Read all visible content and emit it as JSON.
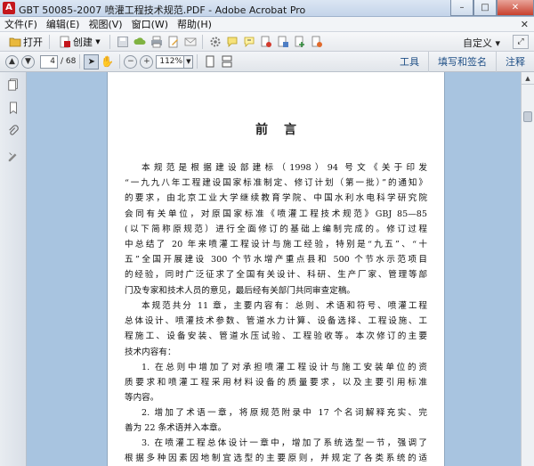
{
  "window": {
    "title": "GBT 50085-2007 喷灌工程技术规范.PDF - Adobe Acrobat Pro",
    "minimize": "–",
    "maximize": "□",
    "close": "✕"
  },
  "menu": {
    "items": [
      "文件(F)",
      "编辑(E)",
      "视图(V)",
      "窗口(W)",
      "帮助(H)"
    ],
    "close": "✕"
  },
  "toolbar": {
    "open_label": "打开",
    "create_label": "创建",
    "customize_label": "自定义"
  },
  "nav": {
    "current_page": "4",
    "total_pages": "/ 68",
    "zoom": "112%",
    "tools_label": "工具",
    "fill_sign_label": "填写和签名",
    "comment_label": "注释"
  },
  "document": {
    "heading": "前言",
    "paragraphs": [
      [
        "本规范是根据建设部建标（1998）94 号文《关于印发",
        "“一九九八年工程建设国家标准制定、修订计划（第一批）”的通知》",
        "的要求，由北京工业大学继续教育学院、中国水利水电科学研究院",
        "会同有关单位，对原国家标准《喷灌工程技术规范》GBJ 85—85",
        "(以下简称原规范）进行全面修订的基础上编制完成的。修订过程",
        "中总结了 20 年来喷灌工程设计与施工经验，特别是“九五”、“十",
        "五”全国开展建设 300 个节水增产重点县和 500 个节水示范项目",
        "的经验，同时广泛征求了全国有关设计、科研、生产厂家、管理等部",
        "门及专家和技术人员的意见，最后经有关部门共同审查定稿。"
      ],
      [
        "本规范共分 11 章，主要内容有：总则、术语和符号、喷灌工程",
        "总体设计、喷灌技术参数、管道水力计算、设备选择、工程设施、工",
        "程施工、设备安装、管道水压试验、工程验收等。本次修订的主要",
        "技术内容有："
      ],
      [
        "1. 在总则中增加了对承担喷灌工程设计与施工安装单位的资",
        "质要求和喷灌工程采用材料设备的质量要求，以及主要引用标准",
        "等内容。"
      ],
      [
        "2. 增加了术语一章，将原规范附录中 17 个名词解释充实、完",
        "善为 22 条术语并入本章。"
      ],
      [
        "3. 在喷灌工程总体设计一章中，增加了系统选型一节，强调了",
        "根据多种因素因地制宜选型的主要原则，并规定了各类系统的适"
      ]
    ]
  }
}
